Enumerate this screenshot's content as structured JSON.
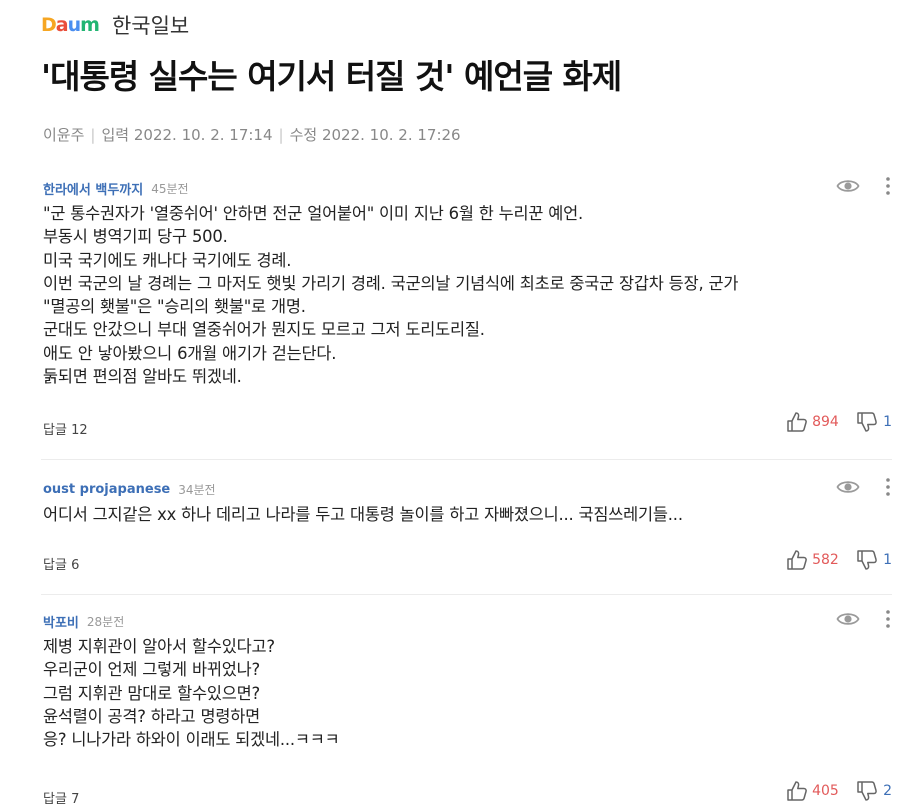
{
  "header": {
    "logo": {
      "d": "D",
      "a": "a",
      "u": "u",
      "m": "m"
    },
    "press": "한국일보"
  },
  "article": {
    "title": "'대통령 실수는 여기서 터질 것' 예언글 화제",
    "author": "이윤주",
    "published_label": "입력",
    "published": "2022. 10. 2. 17:14",
    "modified_label": "수정",
    "modified": "2022. 10. 2. 17:26"
  },
  "labels": {
    "reply": "답글"
  },
  "colors": {
    "like": "#e25a5a",
    "dislike": "#3d6fb6",
    "author": "#3d6fb6"
  },
  "comments": [
    {
      "author": "한라에서 백두까지",
      "time": "45분전",
      "body": "\"군 통수권자가 '열중쉬어' 안하면 전군 얼어붙어\" 이미 지난 6월 한 누리꾼 예언.\n부동시 병역기피 당구 500.\n미국 국기에도 캐나다 국기에도 경례.\n이번 국군의 날 경례는 그 마저도 햇빛 가리기 경례. 국군의날 기념식에 최초로 중국군 장갑차 등장, 군가\n\"멸공의 횃불\"은 \"승리의 횃불\"로 개명.\n군대도 안갔으니 부대 열중쉬어가 뭔지도 모르고 그저 도리도리질.\n애도 안 낳아봤으니 6개월 애기가 걷는단다.\n둙되면 편의점 알바도 뛰겠네.",
      "replies": "12",
      "likes": "894",
      "dislikes": "1"
    },
    {
      "author": "oust projapanese",
      "time": "34분전",
      "body": "어디서 그지같은 xx 하나 데리고 나라를 두고 대통령 놀이를 하고 자빠졌으니... 국짐쓰레기들...",
      "replies": "6",
      "likes": "582",
      "dislikes": "1"
    },
    {
      "author": "박포비",
      "time": "28분전",
      "body": "제병 지휘관이 알아서 할수있다고?\n우리군이 언제 그렇게 바뀌었나?\n그럼 지휘관 맘대로 할수있으면?\n윤석렬이 공격? 하라고 명령하면\n응? 니나가라 하와이 이래도 되겠네...ㅋㅋㅋ",
      "replies": "7",
      "likes": "405",
      "dislikes": "2"
    }
  ]
}
